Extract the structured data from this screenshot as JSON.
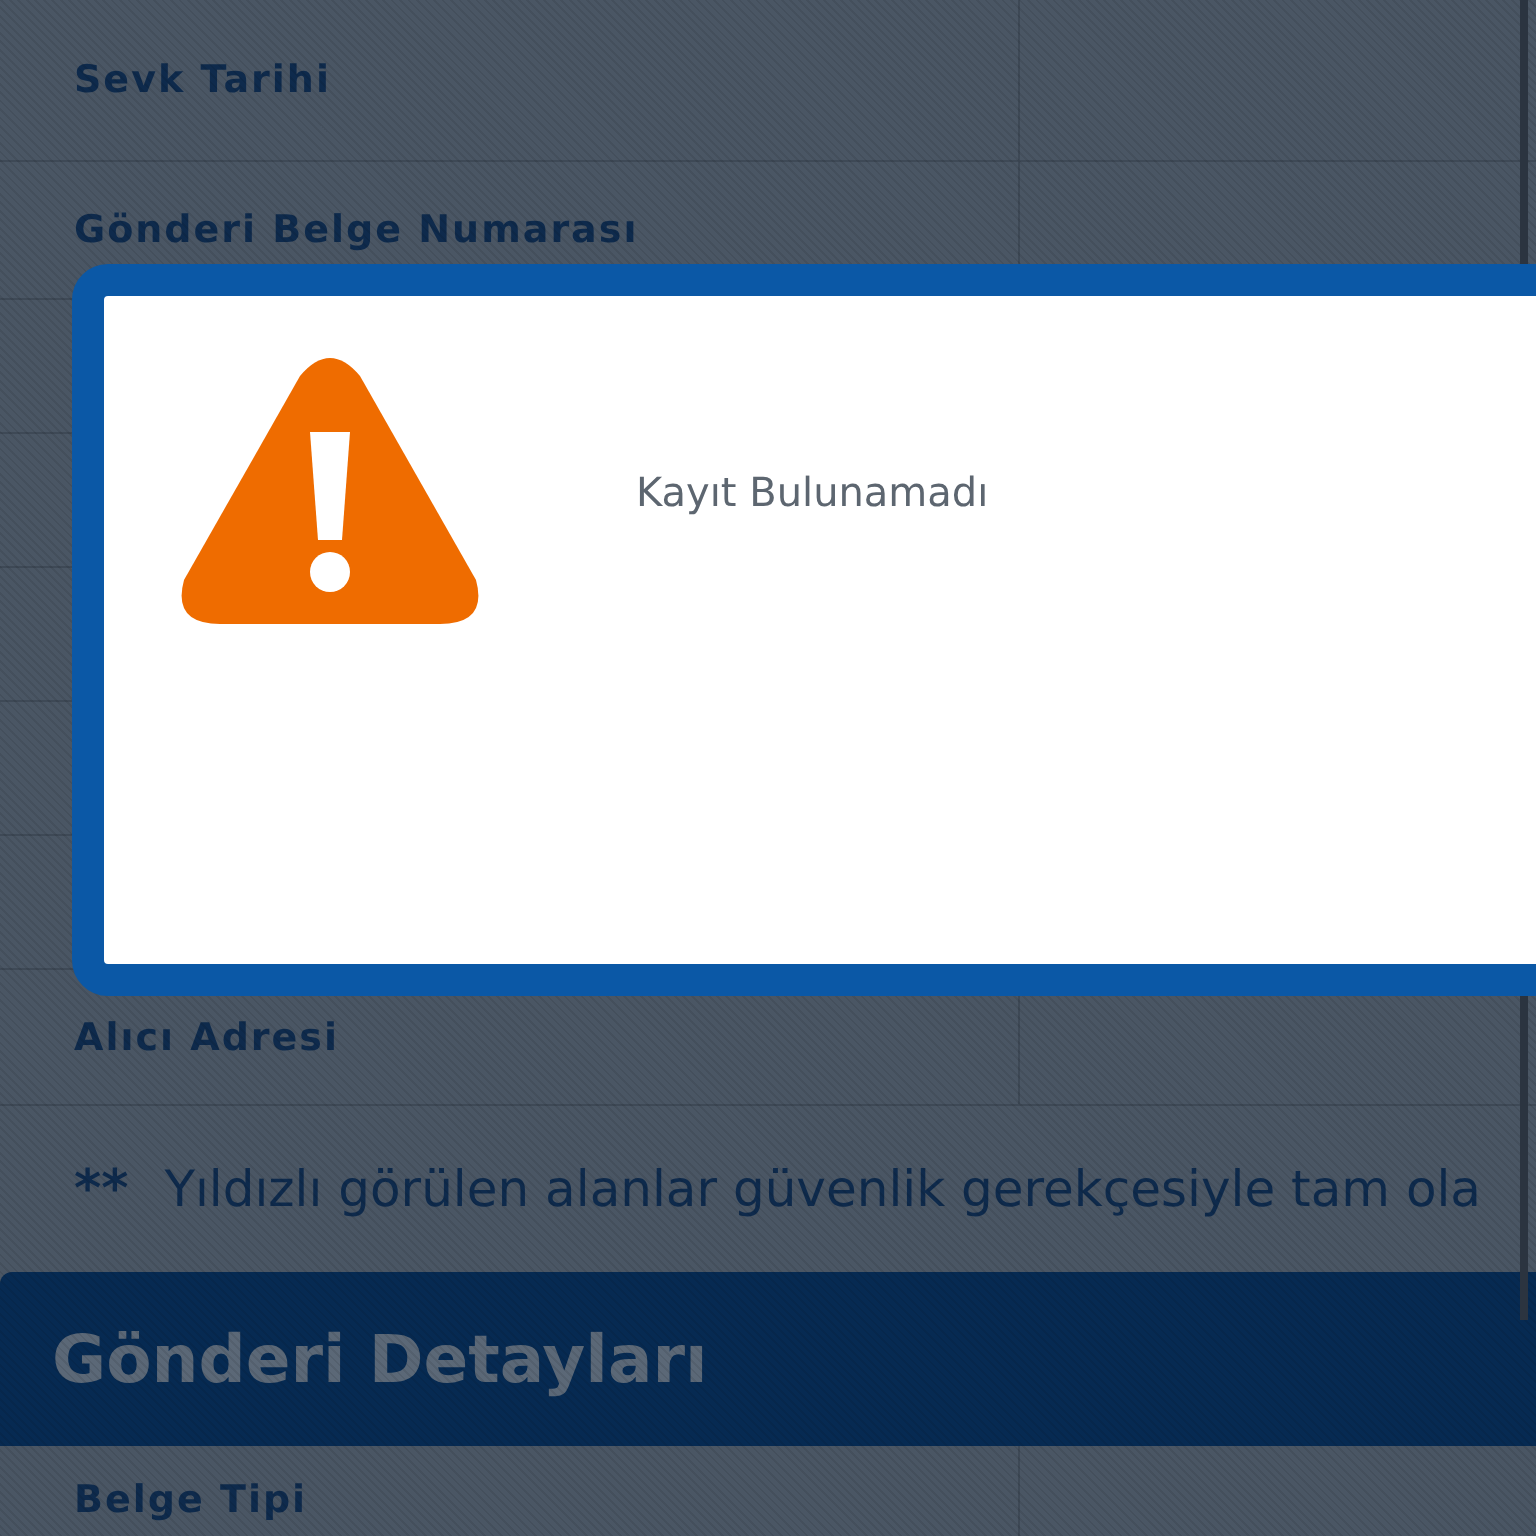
{
  "fields_top": [
    {
      "label": "Sevk Tarihi"
    },
    {
      "label": "Gönderi Belge Numarası"
    }
  ],
  "fields_bottom": [
    {
      "label": "Alıcı Adresi"
    }
  ],
  "note": {
    "marker": "**",
    "text": "Yıldızlı görülen alanlar güvenlik gerekçesiyle tam ola"
  },
  "section": {
    "title": "Gönderi Detayları",
    "fields": [
      {
        "label": "Belge Tipi"
      }
    ]
  },
  "dialog": {
    "message": "Kayıt Bulunamadı"
  }
}
